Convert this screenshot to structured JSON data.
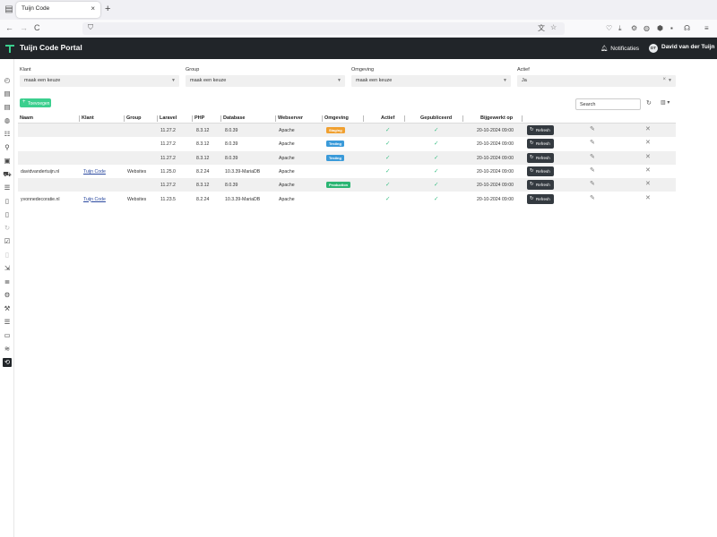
{
  "browser": {
    "tab_title": "Tuijn Code",
    "tab_close": "×",
    "new_tab": "+",
    "back": "←",
    "forward": "→",
    "reload": "C",
    "menu": "≡"
  },
  "header": {
    "title": "Tuijn Code Portal",
    "notifications": "Notificaties",
    "avatar_initials": "DT",
    "user": "David van der Tuijn"
  },
  "filters": [
    {
      "label": "Klant",
      "value": "maak een keuze",
      "clearable": false
    },
    {
      "label": "Group",
      "value": "maak een keuze",
      "clearable": false
    },
    {
      "label": "Omgeving",
      "value": "maak een keuze",
      "clearable": false
    },
    {
      "label": "Actief",
      "value": "Ja",
      "clearable": true
    }
  ],
  "toolbar": {
    "add_label": "Toevoegen",
    "search_placeholder": "Search"
  },
  "table": {
    "columns": [
      "Naam",
      "Klant",
      "Group",
      "Laravel",
      "PHP",
      "Database",
      "Webserver",
      "Omgeving",
      "Actief",
      "Gepubliceerd",
      "Bijgewerkt op"
    ],
    "refresh_label": "Refresh",
    "rows": [
      {
        "naam": "",
        "klant": "",
        "group": "",
        "laravel": "11.27.2",
        "php": "8.3.12",
        "database": "8.0.39",
        "webserver": "Apache",
        "omgeving": "Staging",
        "bijgewerkt": "20-10-2024 09:00"
      },
      {
        "naam": "",
        "klant": "",
        "group": "",
        "laravel": "11.27.2",
        "php": "8.3.12",
        "database": "8.0.39",
        "webserver": "Apache",
        "omgeving": "Testing",
        "bijgewerkt": "20-10-2024 09:00"
      },
      {
        "naam": "",
        "klant": "",
        "group": "",
        "laravel": "11.27.2",
        "php": "8.3.12",
        "database": "8.0.39",
        "webserver": "Apache",
        "omgeving": "Testing",
        "bijgewerkt": "20-10-2024 09:00"
      },
      {
        "naam": "davidvandertuijn.nl",
        "klant": "Tuijn Code",
        "group": "Websites",
        "laravel": "11.25.0",
        "php": "8.2.24",
        "database": "10.3.39-MariaDB",
        "webserver": "Apache",
        "omgeving": "",
        "bijgewerkt": "20-10-2024 09:00"
      },
      {
        "naam": "",
        "klant": "",
        "group": "",
        "laravel": "11.27.2",
        "php": "8.3.12",
        "database": "8.0.39",
        "webserver": "Apache",
        "omgeving": "Production",
        "bijgewerkt": "20-10-2024 09:00"
      },
      {
        "naam": "yvonnedecoratie.nl",
        "klant": "Tuijn Code",
        "group": "Websites",
        "laravel": "11.23.5",
        "php": "8.2.24",
        "database": "10.3.39-MariaDB",
        "webserver": "Apache",
        "omgeving": "",
        "bijgewerkt": "20-10-2024 09:00"
      }
    ]
  },
  "colors": {
    "Staging": "#f0a030",
    "Testing": "#3a9ad9",
    "Production": "#2bb573",
    "accent": "#3bcf8e",
    "header_bg": "#212529"
  },
  "icons": {
    "sidebar": [
      "dashboard-icon",
      "document-icon",
      "document-icon",
      "globe-icon",
      "users-icon",
      "network-icon",
      "calendar-icon",
      "car-icon",
      "list-icon",
      "file-icon",
      "file-icon",
      "sync-icon",
      "inbox-check-icon",
      "file-icon",
      "file-export-icon",
      "stack-icon",
      "gear-icon",
      "wrench-icon",
      "list-icon",
      "window-icon",
      "wifi-icon",
      "repeat-icon"
    ]
  }
}
